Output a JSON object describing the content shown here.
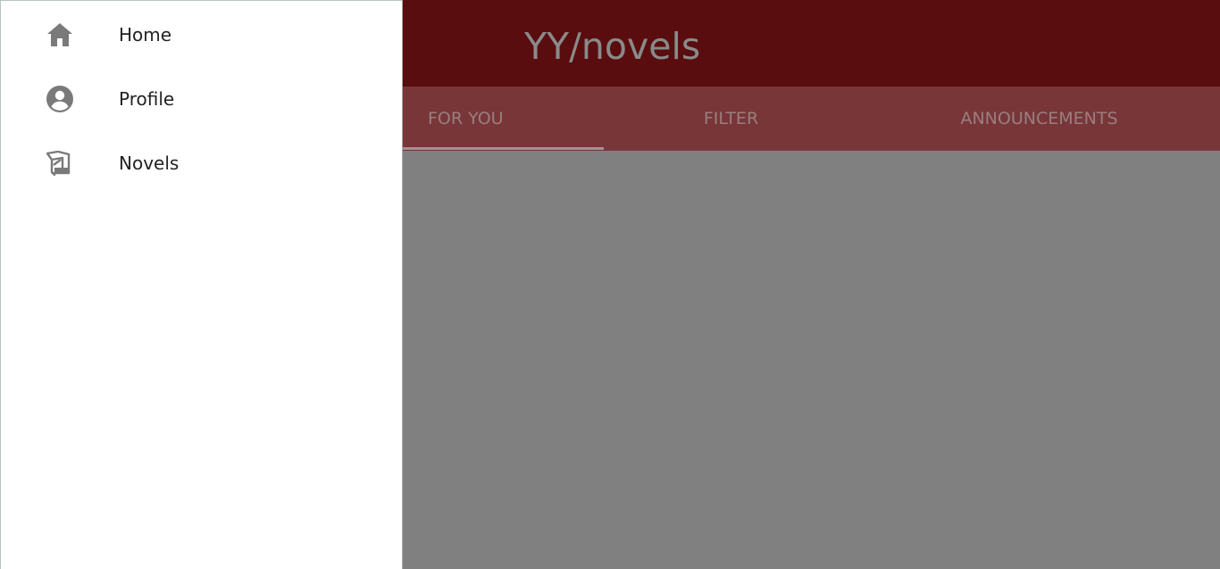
{
  "app": {
    "title": "YY/novels",
    "colors": {
      "appbar": "#5a0d0e",
      "tabbar": "#783638",
      "scrim": "#808080",
      "drawer": "#ffffff",
      "icon": "#7a7a7a"
    }
  },
  "tabs": [
    {
      "label": "FOR YOU",
      "selected": true
    },
    {
      "label": "FILTER",
      "selected": false
    },
    {
      "label": "ANNOUNCEMENTS",
      "selected": false
    }
  ],
  "drawer": {
    "items": [
      {
        "label": "Home",
        "icon": "home-icon"
      },
      {
        "label": "Profile",
        "icon": "account-circle-icon"
      },
      {
        "label": "Novels",
        "icon": "book-icon"
      }
    ]
  }
}
